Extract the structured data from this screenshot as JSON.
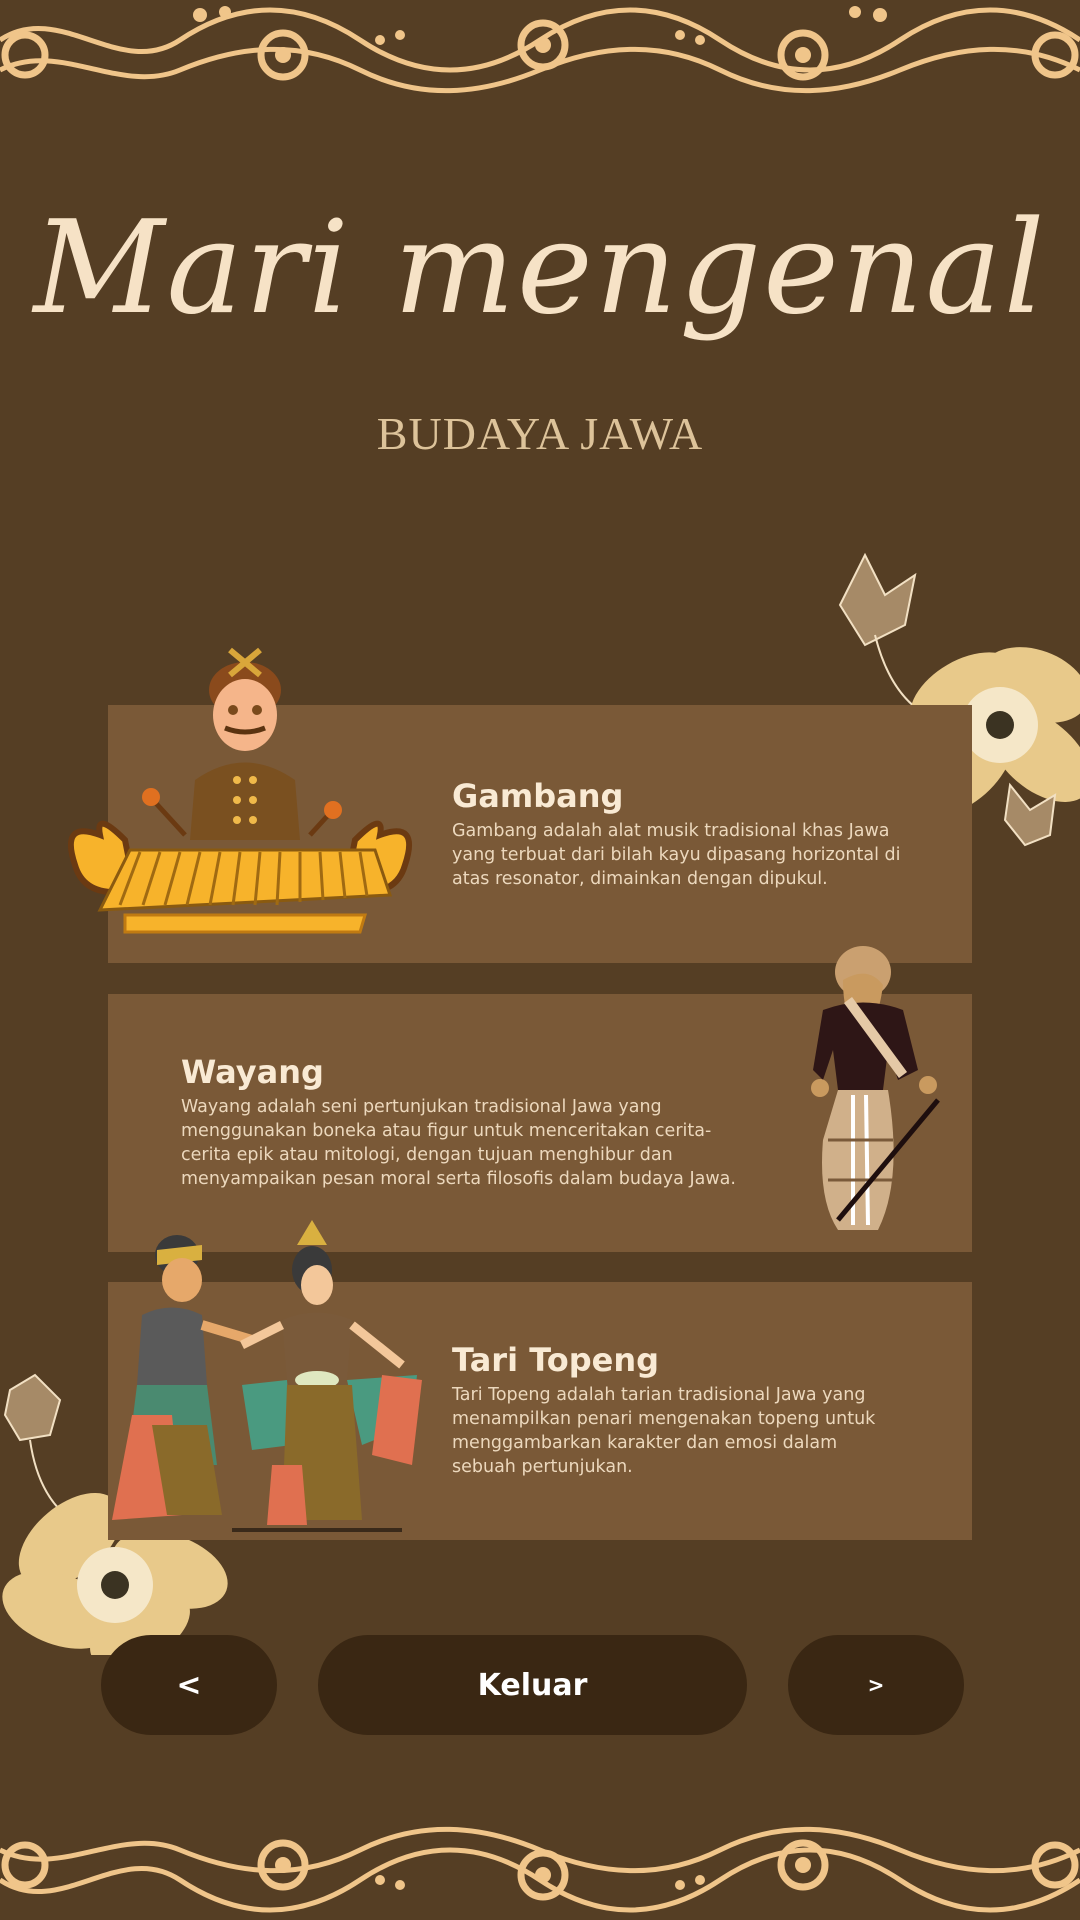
{
  "header": {
    "title": "Mari mengenal",
    "subtitle": "BUDAYA JAWA"
  },
  "cards": [
    {
      "title": "Gambang",
      "description": "Gambang adalah alat musik tradisional khas Jawa yang terbuat dari bilah kayu dipasang horizontal di atas resonator, dimainkan dengan dipukul.",
      "image": "gambang-player-illustration"
    },
    {
      "title": "Wayang",
      "description": "Wayang adalah seni pertunjukan tradisional Jawa yang menggunakan boneka atau figur untuk menceritakan cerita-cerita epik atau mitologi, dengan tujuan menghibur dan menyampaikan pesan moral serta filosofis dalam budaya Jawa.",
      "image": "wayang-puppet-illustration"
    },
    {
      "title": "Tari Topeng",
      "description": "Tari Topeng adalah tarian tradisional Jawa yang menampilkan penari mengenakan topeng untuk menggambarkan karakter dan emosi dalam sebuah pertunjukan.",
      "image": "topeng-dancers-illustration"
    }
  ],
  "nav": {
    "prev_label": "<",
    "exit_label": "Keluar",
    "next_label": ">"
  },
  "colors": {
    "background": "#553e24",
    "card": "#7a5937",
    "button": "#3a2713",
    "ornament": "#f0c58a",
    "title": "#f6e2c6"
  }
}
